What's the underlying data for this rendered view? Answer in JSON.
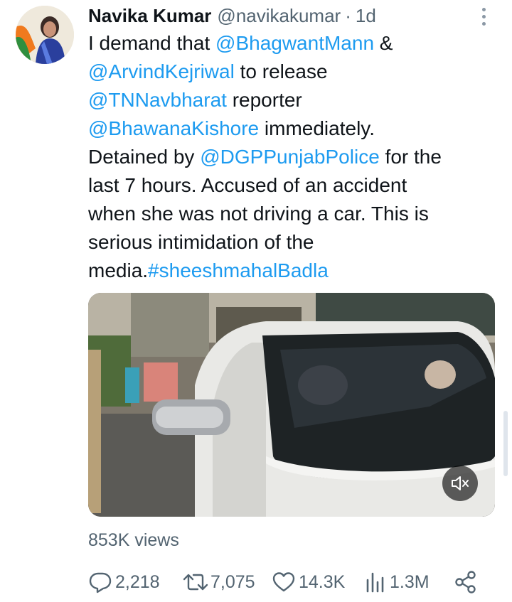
{
  "tweet": {
    "author": {
      "name": "Navika Kumar",
      "handle": "@navikakumar",
      "separator": "·",
      "time": "1d"
    },
    "text_lines": [
      [
        {
          "t": "I demand that "
        },
        {
          "t": "@BhagwantMann",
          "m": true
        },
        {
          "t": " &"
        }
      ],
      [
        {
          "t": "@ArvindKejriwal",
          "m": true
        },
        {
          "t": " to release"
        }
      ],
      [
        {
          "t": "@TNNavbharat",
          "m": true
        },
        {
          "t": " reporter"
        }
      ],
      [
        {
          "t": "@BhawanaKishore",
          "m": true
        },
        {
          "t": " immediately."
        }
      ],
      [
        {
          "t": "Detained by "
        },
        {
          "t": "@DGPPunjabPolice",
          "m": true
        },
        {
          "t": " for the"
        }
      ],
      [
        {
          "t": "last 7 hours. Accused of an accident"
        }
      ],
      [
        {
          "t": "when she was not driving a car. This is"
        }
      ],
      [
        {
          "t": "serious intimidation of the"
        }
      ],
      [
        {
          "t": "media."
        },
        {
          "t": "#sheeshmahalBadla",
          "m": true
        }
      ]
    ],
    "views": {
      "count": "853K",
      "label": "views"
    },
    "actions": {
      "replies": "2,218",
      "retweets": "7,075",
      "likes": "14.3K",
      "views": "1.3M"
    }
  },
  "colors": {
    "link": "#1d9bf0",
    "text": "#0f1419",
    "muted": "#536471"
  },
  "icons": [
    "more-vertical-icon",
    "speaker-muted-icon",
    "reply-icon",
    "retweet-icon",
    "like-icon",
    "views-icon",
    "share-icon"
  ]
}
